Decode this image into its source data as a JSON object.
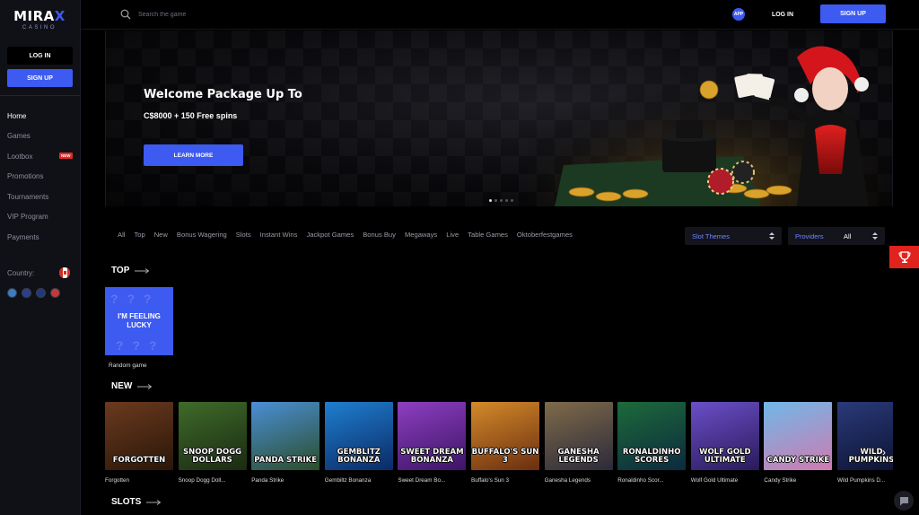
{
  "brand": {
    "name_a": "MIRA",
    "name_x": "X",
    "sub": "CASINO"
  },
  "sidebar": {
    "login": "LOG IN",
    "signup": "SIGN UP",
    "items": [
      {
        "label": "Home",
        "active": true
      },
      {
        "label": "Games"
      },
      {
        "label": "Lootbox",
        "badge": "NEW"
      },
      {
        "label": "Promotions"
      },
      {
        "label": "Tournaments"
      },
      {
        "label": "VIP Program"
      },
      {
        "label": "Payments"
      }
    ],
    "country_label": "Country:"
  },
  "topbar": {
    "search_placeholder": "Search the game",
    "app": "APP",
    "login": "LOG IN",
    "signup": "SIGN UP"
  },
  "banner": {
    "title": "Welcome Package Up To",
    "subtitle": "C$8000 + 150 Free spins",
    "cta": "LEARN MORE",
    "slides": 5,
    "active_slide": 1
  },
  "filters": [
    "All",
    "Top",
    "New",
    "Bonus Wagering",
    "Slots",
    "Instant Wins",
    "Jackpot Games",
    "Bonus Buy",
    "Megaways",
    "Live",
    "Table Games",
    "Oktoberfestgames"
  ],
  "selects": {
    "themes": "Slot Themes",
    "providers_label": "Providers",
    "providers_value": "All"
  },
  "sections": {
    "top": "TOP",
    "new": "NEW",
    "slots": "SLOTS"
  },
  "top_games": [
    {
      "thumb_text": "I'M FEELING LUCKY",
      "name": "Random game"
    }
  ],
  "new_games": [
    {
      "name": "Forgotten",
      "thumb": "FORGOTTEN",
      "colors": [
        "#6b3a1f",
        "#2a1608"
      ]
    },
    {
      "name": "Snoop Dogg Doll...",
      "thumb": "SNOOP DOGG DOLLARS",
      "colors": [
        "#3f6b2a",
        "#1a2a12"
      ]
    },
    {
      "name": "Panda Strike",
      "thumb": "PANDA STRIKE",
      "colors": [
        "#4a8fd6",
        "#2b4d2a"
      ]
    },
    {
      "name": "Gembiltz Bonanza",
      "thumb": "GEMBLITZ BONANZA",
      "colors": [
        "#1f7fd0",
        "#0b2a66"
      ]
    },
    {
      "name": "Sweet Dream Bo...",
      "thumb": "SWEET DREAM BONANZA",
      "colors": [
        "#8d3fc0",
        "#3d1466"
      ]
    },
    {
      "name": "Buffalo's Sun 3",
      "thumb": "BUFFALO'S SUN 3",
      "colors": [
        "#d48a2a",
        "#6a2e10"
      ]
    },
    {
      "name": "Ganesha Legends",
      "thumb": "GANESHA LEGENDS",
      "colors": [
        "#7f6b4a",
        "#2c2a3a"
      ]
    },
    {
      "name": "Ronaldinho Scor...",
      "thumb": "RONALDINHO SCORES",
      "colors": [
        "#1d6a3a",
        "#0c2a3f"
      ]
    },
    {
      "name": "Wolf Gold Ultimate",
      "thumb": "WOLF GOLD ULTIMATE",
      "colors": [
        "#6a4fc8",
        "#2a1a5a"
      ]
    },
    {
      "name": "Candy Strike",
      "thumb": "CANDY STRIKE",
      "colors": [
        "#6fb8e8",
        "#d07ab0"
      ]
    },
    {
      "name": "Wild Pumpkins D...",
      "thumb": "WILD PUMPKINS",
      "colors": [
        "#2a3a7a",
        "#0c1230"
      ]
    }
  ],
  "colors": {
    "accent": "#3d5af1",
    "sidebar_bg": "#101117",
    "new_badge": "#e02a2a",
    "trophy": "#e0231c"
  },
  "icons": [
    "search-icon",
    "trophy-icon",
    "chat-icon",
    "arrow-right-icon",
    "chevron-updown-icon"
  ]
}
